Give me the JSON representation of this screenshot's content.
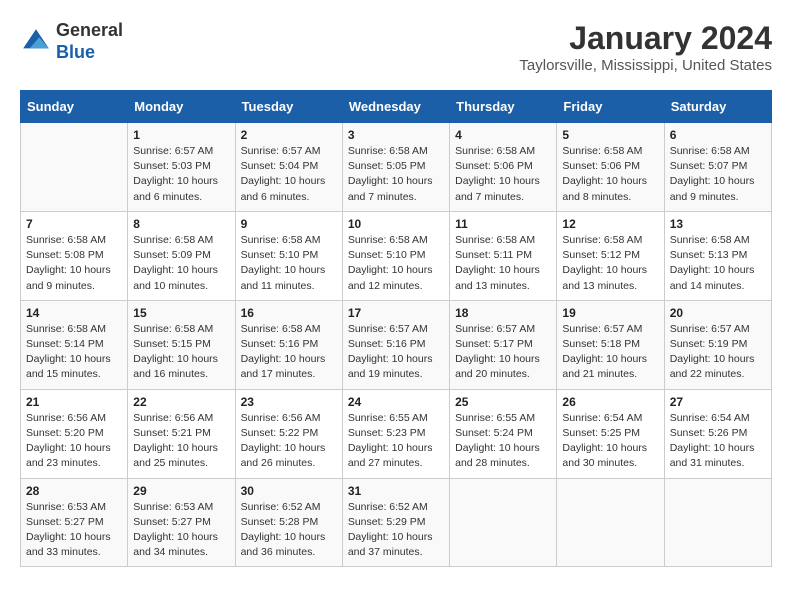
{
  "logo": {
    "general": "General",
    "blue": "Blue"
  },
  "title": "January 2024",
  "location": "Taylorsville, Mississippi, United States",
  "weekdays": [
    "Sunday",
    "Monday",
    "Tuesday",
    "Wednesday",
    "Thursday",
    "Friday",
    "Saturday"
  ],
  "weeks": [
    [
      {
        "day": "",
        "info": ""
      },
      {
        "day": "1",
        "info": "Sunrise: 6:57 AM\nSunset: 5:03 PM\nDaylight: 10 hours\nand 6 minutes."
      },
      {
        "day": "2",
        "info": "Sunrise: 6:57 AM\nSunset: 5:04 PM\nDaylight: 10 hours\nand 6 minutes."
      },
      {
        "day": "3",
        "info": "Sunrise: 6:58 AM\nSunset: 5:05 PM\nDaylight: 10 hours\nand 7 minutes."
      },
      {
        "day": "4",
        "info": "Sunrise: 6:58 AM\nSunset: 5:06 PM\nDaylight: 10 hours\nand 7 minutes."
      },
      {
        "day": "5",
        "info": "Sunrise: 6:58 AM\nSunset: 5:06 PM\nDaylight: 10 hours\nand 8 minutes."
      },
      {
        "day": "6",
        "info": "Sunrise: 6:58 AM\nSunset: 5:07 PM\nDaylight: 10 hours\nand 9 minutes."
      }
    ],
    [
      {
        "day": "7",
        "info": "Sunrise: 6:58 AM\nSunset: 5:08 PM\nDaylight: 10 hours\nand 9 minutes."
      },
      {
        "day": "8",
        "info": "Sunrise: 6:58 AM\nSunset: 5:09 PM\nDaylight: 10 hours\nand 10 minutes."
      },
      {
        "day": "9",
        "info": "Sunrise: 6:58 AM\nSunset: 5:10 PM\nDaylight: 10 hours\nand 11 minutes."
      },
      {
        "day": "10",
        "info": "Sunrise: 6:58 AM\nSunset: 5:10 PM\nDaylight: 10 hours\nand 12 minutes."
      },
      {
        "day": "11",
        "info": "Sunrise: 6:58 AM\nSunset: 5:11 PM\nDaylight: 10 hours\nand 13 minutes."
      },
      {
        "day": "12",
        "info": "Sunrise: 6:58 AM\nSunset: 5:12 PM\nDaylight: 10 hours\nand 13 minutes."
      },
      {
        "day": "13",
        "info": "Sunrise: 6:58 AM\nSunset: 5:13 PM\nDaylight: 10 hours\nand 14 minutes."
      }
    ],
    [
      {
        "day": "14",
        "info": "Sunrise: 6:58 AM\nSunset: 5:14 PM\nDaylight: 10 hours\nand 15 minutes."
      },
      {
        "day": "15",
        "info": "Sunrise: 6:58 AM\nSunset: 5:15 PM\nDaylight: 10 hours\nand 16 minutes."
      },
      {
        "day": "16",
        "info": "Sunrise: 6:58 AM\nSunset: 5:16 PM\nDaylight: 10 hours\nand 17 minutes."
      },
      {
        "day": "17",
        "info": "Sunrise: 6:57 AM\nSunset: 5:16 PM\nDaylight: 10 hours\nand 19 minutes."
      },
      {
        "day": "18",
        "info": "Sunrise: 6:57 AM\nSunset: 5:17 PM\nDaylight: 10 hours\nand 20 minutes."
      },
      {
        "day": "19",
        "info": "Sunrise: 6:57 AM\nSunset: 5:18 PM\nDaylight: 10 hours\nand 21 minutes."
      },
      {
        "day": "20",
        "info": "Sunrise: 6:57 AM\nSunset: 5:19 PM\nDaylight: 10 hours\nand 22 minutes."
      }
    ],
    [
      {
        "day": "21",
        "info": "Sunrise: 6:56 AM\nSunset: 5:20 PM\nDaylight: 10 hours\nand 23 minutes."
      },
      {
        "day": "22",
        "info": "Sunrise: 6:56 AM\nSunset: 5:21 PM\nDaylight: 10 hours\nand 25 minutes."
      },
      {
        "day": "23",
        "info": "Sunrise: 6:56 AM\nSunset: 5:22 PM\nDaylight: 10 hours\nand 26 minutes."
      },
      {
        "day": "24",
        "info": "Sunrise: 6:55 AM\nSunset: 5:23 PM\nDaylight: 10 hours\nand 27 minutes."
      },
      {
        "day": "25",
        "info": "Sunrise: 6:55 AM\nSunset: 5:24 PM\nDaylight: 10 hours\nand 28 minutes."
      },
      {
        "day": "26",
        "info": "Sunrise: 6:54 AM\nSunset: 5:25 PM\nDaylight: 10 hours\nand 30 minutes."
      },
      {
        "day": "27",
        "info": "Sunrise: 6:54 AM\nSunset: 5:26 PM\nDaylight: 10 hours\nand 31 minutes."
      }
    ],
    [
      {
        "day": "28",
        "info": "Sunrise: 6:53 AM\nSunset: 5:27 PM\nDaylight: 10 hours\nand 33 minutes."
      },
      {
        "day": "29",
        "info": "Sunrise: 6:53 AM\nSunset: 5:27 PM\nDaylight: 10 hours\nand 34 minutes."
      },
      {
        "day": "30",
        "info": "Sunrise: 6:52 AM\nSunset: 5:28 PM\nDaylight: 10 hours\nand 36 minutes."
      },
      {
        "day": "31",
        "info": "Sunrise: 6:52 AM\nSunset: 5:29 PM\nDaylight: 10 hours\nand 37 minutes."
      },
      {
        "day": "",
        "info": ""
      },
      {
        "day": "",
        "info": ""
      },
      {
        "day": "",
        "info": ""
      }
    ]
  ]
}
